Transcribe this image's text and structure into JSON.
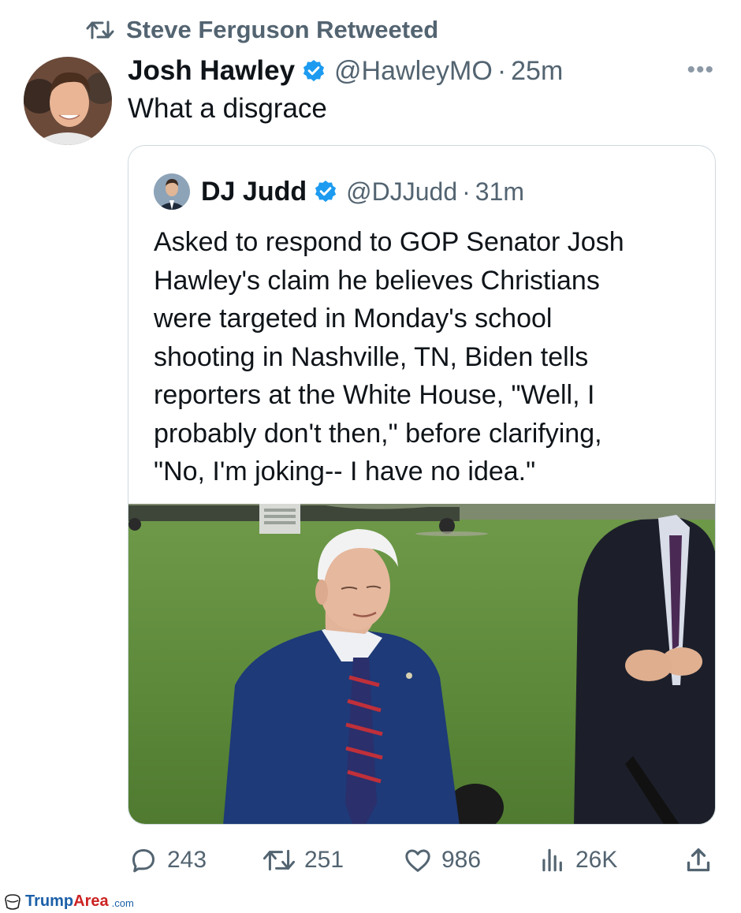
{
  "retweet": {
    "icon": "retweet-icon",
    "label": "Steve Ferguson Retweeted"
  },
  "tweet": {
    "author_name": "Josh Hawley",
    "handle": "@HawleyMO",
    "separator": "·",
    "time": "25m",
    "more": "•••",
    "text": "What a disgrace"
  },
  "quote": {
    "author_name": "DJ Judd",
    "handle": "@DJJudd",
    "separator": "·",
    "time": "31m",
    "lines": [
      "Asked to respond to GOP Senator Josh",
      "Hawley's claim he believes Christians",
      "were targeted in Monday's school",
      "shooting in Nashville, TN, Biden tells",
      "reporters at the White House, \"Well, I",
      "probably don't then,\" before clarifying,",
      "\"No, I'm joking-- I have no idea.\""
    ]
  },
  "actions": {
    "replies": "243",
    "retweets": "251",
    "likes": "986",
    "views": "26K"
  },
  "watermark": {
    "brand_blue": "Trump",
    "brand_red": "Area",
    "domain": ".com"
  },
  "colors": {
    "verified": "#1d9bf0",
    "muted": "#536471",
    "border": "#cfd9de"
  }
}
